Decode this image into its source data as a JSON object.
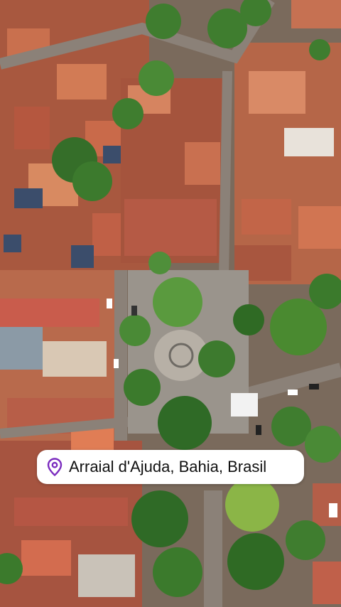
{
  "overlay": {
    "location_label": "Arraial d'Ajuda, Bahia, Brasil",
    "icon": "location-pin-icon",
    "accent_color": "#7b2cbf"
  },
  "scene": {
    "description_type": "aerial-photo"
  }
}
